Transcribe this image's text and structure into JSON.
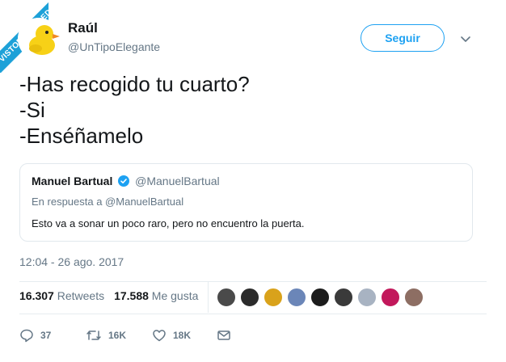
{
  "watermark": {
    "text": "VISTOENLASREDES"
  },
  "author": {
    "name": "Raúl",
    "handle": "@UnTipoElegante"
  },
  "follow_button": {
    "label": "Seguir"
  },
  "tweet": {
    "lines": [
      "-Has recogido tu cuarto?",
      "-Si",
      "-Enséñamelo"
    ]
  },
  "quoted_tweet": {
    "name": "Manuel Bartual",
    "handle": "@ManuelBartual",
    "reply_to": "En respuesta a @ManuelBartual",
    "text": "Esto va a sonar un poco raro, pero no encuentro la puerta."
  },
  "timestamp": "12:04 - 26 ago. 2017",
  "stats": {
    "retweets_count": "16.307",
    "retweets_label": "Retweets",
    "likes_count": "17.588",
    "likes_label": "Me gusta"
  },
  "liker_avatars": [
    {
      "color": "#4a4a4a"
    },
    {
      "color": "#2b2b2b"
    },
    {
      "color": "#d9a21b"
    },
    {
      "color": "#6b86b8"
    },
    {
      "color": "#1c1c1c"
    },
    {
      "color": "#3a3a3a"
    },
    {
      "color": "#a8b3c2"
    },
    {
      "color": "#c2185b"
    },
    {
      "color": "#8d6e63"
    }
  ],
  "actions": {
    "reply_count": "37",
    "retweet_count": "16K",
    "like_count": "18K"
  },
  "colors": {
    "accent": "#1da1f2",
    "muted": "#657786",
    "verified": "#1da1f2",
    "watermark": "#1da1d8"
  }
}
